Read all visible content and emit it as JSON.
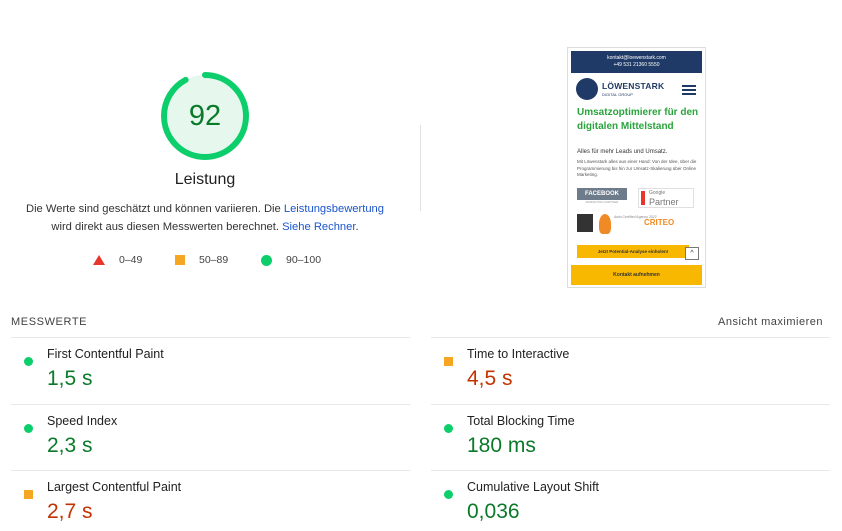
{
  "gauge": {
    "score": "92",
    "score_fraction": 0.92,
    "title": "Leistung",
    "desc_part1": "Die Werte sind geschätzt und können variieren. Die ",
    "desc_link1": "Leistungsbewertung",
    "desc_part2": "wird direkt aus diesen Messwerten berechnet. ",
    "desc_link2": "Siehe Rechner",
    "desc_part3": ".",
    "colors": {
      "good": "#0cce6b",
      "average": "#f5a623",
      "poor": "#e8362c"
    }
  },
  "legend": [
    {
      "icon": "triangle-icon",
      "label": "0–49"
    },
    {
      "icon": "square-icon",
      "label": "50–89"
    },
    {
      "icon": "circle-icon",
      "label": "90–100"
    }
  ],
  "thumbnail": {
    "contact_email": "kontakt@loewenstark.com",
    "contact_phone": "+49 531 21360 5550",
    "brand": "LÖWENSTARK",
    "brand_sub": "DIGITAL GROUP",
    "headline": "Umsatzoptimierer für den digitalen Mittelstand",
    "sub": "Alles für mehr Leads und Umsatz.",
    "text": "Mit Löwenstark alles aus einer Hand: Von der Idee, über die Programmierung bis hin zur Umsatz-Skalierung über Online Marketing.",
    "facebook": "FACEBOOK",
    "facebook_sub": "MARKETING PARTNER",
    "google": "Google",
    "partner": "Partner",
    "agency": "Awin Certified Agency 2022",
    "criteo": "CRITEO",
    "btn1": "Jetzt Potential-Analyse einholen!",
    "btn2": "Kontakt aufnehmen",
    "up_arrow": "^"
  },
  "metrics": {
    "title": "MESSWERTE",
    "toggle": "Ansicht maximieren",
    "items": [
      {
        "label": "First Contentful Paint",
        "value": "1,5 s",
        "rating": "good"
      },
      {
        "label": "Time to Interactive",
        "value": "4,5 s",
        "rating": "average"
      },
      {
        "label": "Speed Index",
        "value": "2,3 s",
        "rating": "good"
      },
      {
        "label": "Total Blocking Time",
        "value": "180 ms",
        "rating": "good"
      },
      {
        "label": "Largest Contentful Paint",
        "value": "2,7 s",
        "rating": "average"
      },
      {
        "label": "Cumulative Layout Shift",
        "value": "0,036",
        "rating": "good"
      }
    ]
  }
}
